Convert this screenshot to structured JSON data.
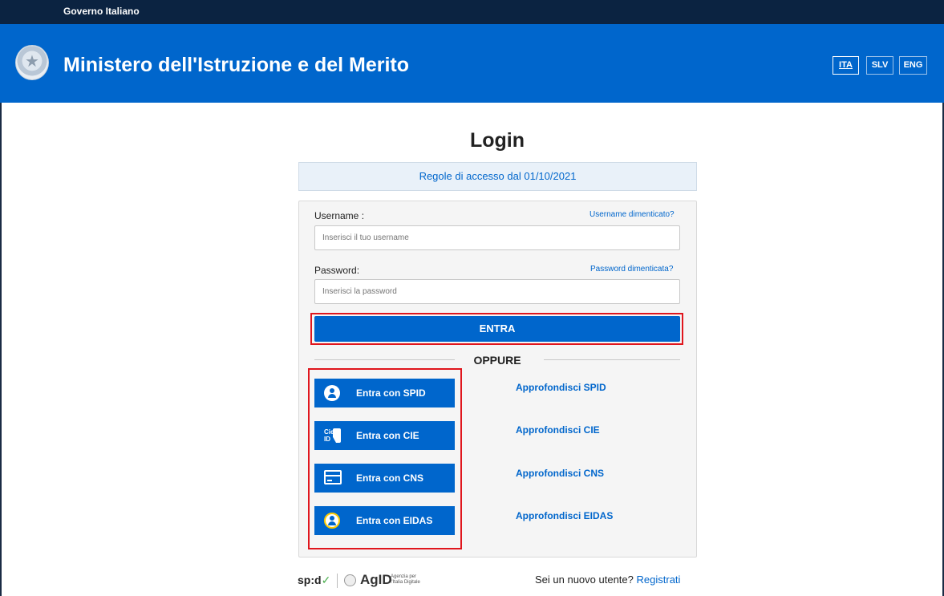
{
  "gov_bar": {
    "label": "Governo Italiano"
  },
  "header": {
    "title": "Ministero dell'Istruzione e del Merito",
    "emblem_icon": "repubblica-emblem-icon"
  },
  "languages": [
    "ITA",
    "SLV",
    "ENG"
  ],
  "login": {
    "title": "Login",
    "rules_link": "Regole di accesso dal 01/10/2021",
    "username_label": "Username :",
    "username_forgot": "Username dimenticato?",
    "username_placeholder": "Inserisci il tuo username",
    "password_label": "Password:",
    "password_forgot": "Password dimenticata?",
    "password_placeholder": "Inserisci la password",
    "submit_label": "ENTRA",
    "or_label": "OPPURE"
  },
  "identity_providers": [
    {
      "label": "Entra con SPID",
      "icon": "person-icon",
      "learn_more": "Approfondisci SPID"
    },
    {
      "label": "Entra con CIE",
      "icon": "cie-card-icon",
      "learn_more": "Approfondisci CIE"
    },
    {
      "label": "Entra con CNS",
      "icon": "credit-card-icon",
      "learn_more": "Approfondisci CNS"
    },
    {
      "label": "Entra con EIDAS",
      "icon": "eidas-icon",
      "learn_more": "Approfondisci EIDAS"
    }
  ],
  "footer": {
    "spid_logo": "sp:d",
    "spid_tick": "✓",
    "agid_logo": "AgID",
    "agid_small_1": "Agenzia per",
    "agid_small_2": "l'Italia Digitale",
    "new_user_text": "Sei un nuovo utente?",
    "register_link": "Registrati"
  },
  "colors": {
    "brand_blue": "#0066cc",
    "gov_bar": "#0b2341",
    "highlight_red": "#e0161d"
  }
}
